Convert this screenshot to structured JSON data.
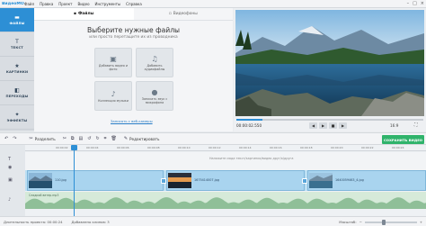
{
  "app": {
    "logo_main": "ВидеоМОНТАЖ",
    "menu": [
      "Файл",
      "Правка",
      "Проект",
      "Видео",
      "Инструменты",
      "Справка"
    ]
  },
  "sidebar": {
    "items": [
      {
        "label": "ФАЙЛЫ",
        "icon": "folder-icon",
        "active": true
      },
      {
        "label": "ТЕКСТ",
        "icon": "text-t-icon",
        "active": false
      },
      {
        "label": "КАРТИНКИ",
        "icon": "star-icon",
        "active": false
      },
      {
        "label": "ПЕРЕХОДЫ",
        "icon": "transitions-icon",
        "active": false
      },
      {
        "label": "ЭФФЕКТЫ",
        "icon": "magic-wand-icon",
        "active": false
      }
    ]
  },
  "files": {
    "tabs": [
      {
        "label": "Файлы",
        "active": true
      },
      {
        "label": "Видеофоны",
        "active": false
      }
    ],
    "title": "Выберите нужные файлы",
    "subtitle": "или просто перетащите их из проводника",
    "tiles": [
      {
        "label": "Добавить видео и фото",
        "icon": "add-media-icon"
      },
      {
        "label": "Добавить аудиофайлы",
        "icon": "add-audio-icon"
      },
      {
        "label": "Коллекция музыки",
        "icon": "music-collection-icon"
      },
      {
        "label": "Записать звук с микрофона",
        "icon": "microphone-icon"
      }
    ],
    "camera_link": "Записать с веб-камеры"
  },
  "player": {
    "time": "00:00:02.550",
    "progress": 0.14,
    "ratio": "16:9"
  },
  "toolbar": {
    "split": "Разделить",
    "edit": "Редактировать",
    "save": "СОХРАНИТЬ ВИДЕО"
  },
  "timeline": {
    "ticks": [
      "00:00:02",
      "00:00:04",
      "00:00:06",
      "00:00:08",
      "00:00:10",
      "00:00:12",
      "00:00:14",
      "00:00:16",
      "00:00:18",
      "00:00:20",
      "00:00:22",
      "00:00:24",
      "00:00:26"
    ],
    "hint": "Наложите сюда текст/картинки/видео друг/к/друга",
    "clips": [
      {
        "name": "110.jpg"
      },
      {
        "name": "1675414007.jpg"
      },
      {
        "name": "1640059463_4.jpg"
      }
    ],
    "audio": "Сладкий ветер.mp3"
  },
  "status": {
    "duration": "Длительность проекта: 00:00:24",
    "clips_added": "Добавлено клипов: 3",
    "zoom_label": "Масштаб:",
    "zoom_level": 0.35
  }
}
